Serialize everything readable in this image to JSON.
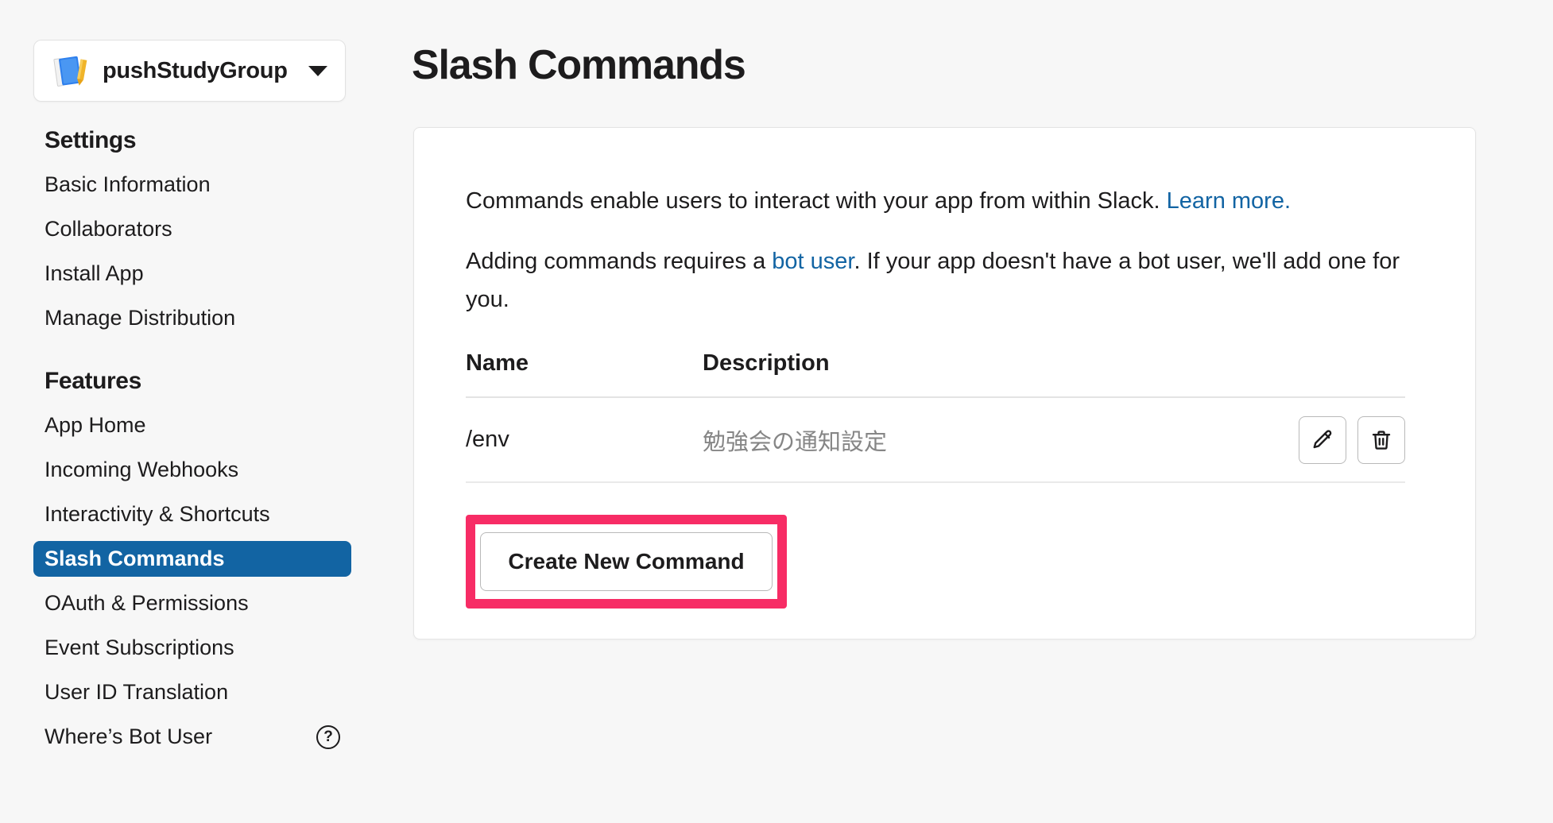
{
  "sidebar": {
    "app_switcher": {
      "app_name": "pushStudyGroup",
      "icon": "notebook-pencil-icon",
      "caret": "chevron-down-icon"
    },
    "sections": [
      {
        "title": "Settings",
        "items": [
          {
            "label": "Basic Information",
            "active": false
          },
          {
            "label": "Collaborators",
            "active": false
          },
          {
            "label": "Install App",
            "active": false
          },
          {
            "label": "Manage Distribution",
            "active": false
          }
        ]
      },
      {
        "title": "Features",
        "items": [
          {
            "label": "App Home",
            "active": false
          },
          {
            "label": "Incoming Webhooks",
            "active": false
          },
          {
            "label": "Interactivity & Shortcuts",
            "active": false
          },
          {
            "label": "Slash Commands",
            "active": true
          },
          {
            "label": "OAuth & Permissions",
            "active": false
          },
          {
            "label": "Event Subscriptions",
            "active": false
          },
          {
            "label": "User ID Translation",
            "active": false
          },
          {
            "label": "Where’s Bot User",
            "active": false,
            "help_icon": "?"
          }
        ]
      }
    ]
  },
  "main": {
    "page_title": "Slash Commands",
    "intro": {
      "paragraph1_before_link": "Commands enable users to interact with your app from within Slack. ",
      "paragraph1_link": "Learn more.",
      "paragraph2_before_link": "Adding commands requires a ",
      "paragraph2_link": "bot user",
      "paragraph2_after_link": ". If your app doesn't have a bot user, we'll add one for you."
    },
    "table": {
      "headers": {
        "name": "Name",
        "description": "Description"
      },
      "rows": [
        {
          "name": "/env",
          "description": "勉強会の通知設定",
          "edit_icon": "pencil-icon",
          "delete_icon": "trash-icon"
        }
      ]
    },
    "create_button_label": "Create New Command"
  },
  "colors": {
    "page_background": "#f7f7f7",
    "card_background": "#ffffff",
    "accent_blue": "#1264a3",
    "link_blue": "#1264a3",
    "annotation_pink": "#f72c65",
    "muted_text": "#868686",
    "text": "#1d1c1d"
  }
}
